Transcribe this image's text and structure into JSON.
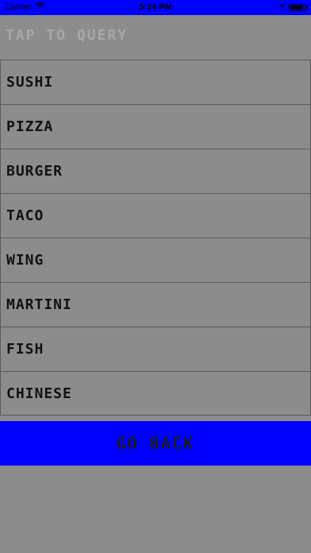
{
  "status_bar": {
    "carrier": "Carrier",
    "time": "5:24 PM",
    "icons": [
      "wifi-icon",
      "location-arrow-icon",
      "battery-icon"
    ],
    "battery_level": 0.9,
    "bg_color": "#0000ff"
  },
  "header": {
    "title": "TAP TO QUERY"
  },
  "menu": {
    "items": [
      {
        "label": "SUSHI"
      },
      {
        "label": "PIZZA"
      },
      {
        "label": "BURGER"
      },
      {
        "label": "TACO"
      },
      {
        "label": "WING"
      },
      {
        "label": "MARTINI"
      },
      {
        "label": "FISH"
      },
      {
        "label": "CHINESE"
      }
    ]
  },
  "footer": {
    "back_label": "GO BACK",
    "button_color": "#0000ff"
  },
  "colors": {
    "background": "#8c8c8c",
    "accent": "#0000ff"
  }
}
